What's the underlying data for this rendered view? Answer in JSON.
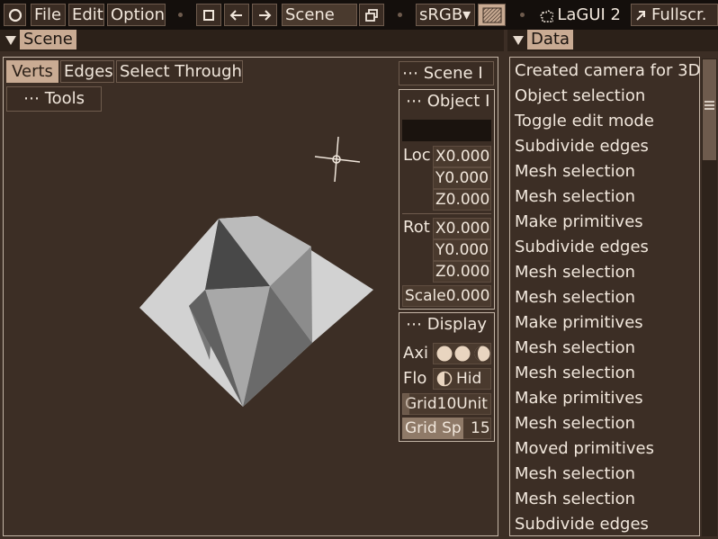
{
  "topbar": {
    "menu": [
      "File",
      "Edit",
      "Option"
    ],
    "scene_field": "Scene",
    "colorspace": "sRGB▾",
    "app_name": "LaGUI 2",
    "fullscreen_label": "Fullscr."
  },
  "scene_panel": {
    "title": "Scene",
    "modes": [
      "Verts",
      "Edges",
      "Select Through"
    ],
    "tools_button": "⋯ Tools",
    "scene_button": "⋯ Scene I",
    "object_button": "⋯ Object I",
    "loc_label": "Loc",
    "loc": [
      "X0.000",
      "Y0.000",
      "Z0.000"
    ],
    "rot_label": "Rot",
    "rot": [
      "X0.000",
      "Y0.000",
      "Z0.000"
    ],
    "scale": "Scale0.000",
    "display_button": "⋯ Display",
    "axis_label": "Axi",
    "floor_label": "Flo",
    "floor_toggle": "Hid",
    "grid_unit": "Grid10Unit",
    "grid_span_label": "Grid Sp",
    "grid_span_value": "15"
  },
  "data_panel": {
    "title": "Data",
    "items": [
      "Created camera for 3D",
      "Object selection",
      "Toggle edit mode",
      "Subdivide edges",
      "Mesh selection",
      "Mesh selection",
      "Make primitives",
      "Subdivide edges",
      "Mesh selection",
      "Mesh selection",
      "Make primitives",
      "Mesh selection",
      "Mesh selection",
      "Make primitives",
      "Mesh selection",
      "Moved primitives",
      "Mesh selection",
      "Mesh selection",
      "Subdivide edges"
    ]
  },
  "colors": {
    "background": "#3c2e25",
    "accent": "#c9ab93",
    "topbar": "#140f0c"
  },
  "icons": [
    "circle-logo-icon",
    "square-icon",
    "arrow-left-icon",
    "arrow-right-icon",
    "window-restore-icon",
    "checker-icon",
    "puzzle-icon",
    "expand-arrow-icon",
    "menu-icon",
    "crosshair-icon"
  ]
}
